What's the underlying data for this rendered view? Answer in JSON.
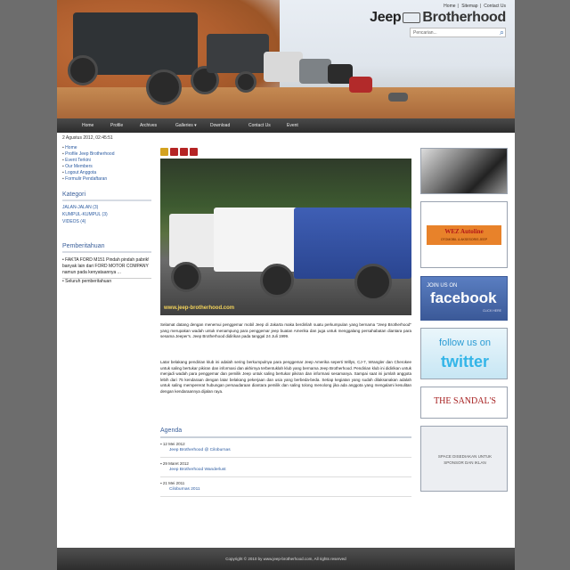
{
  "header": {
    "top_links": [
      "Home",
      "Sitemap",
      "Contact Us"
    ],
    "logo_left": "Jeep",
    "logo_right": "Brotherhood",
    "search_placeholder": "Pencarian..."
  },
  "nav": [
    "Home",
    "Profile",
    "Archives",
    "Galleries ▾",
    "Download",
    "Contact Us",
    "Event"
  ],
  "sidebar": {
    "date": "2 Agustus 2012, 02:45:51",
    "links": [
      "Home",
      "Profile Jeep Brotherhood",
      "Event Terkini",
      "Our Members",
      "Logout Anggota",
      "Formulir Pendaftaran"
    ],
    "category_title": "Kategori",
    "categories": [
      "JALAN-JALAN (3)",
      "KUMPUL-KUMPUL (3)",
      "VIDEOS (4)"
    ],
    "announcement_title": "Pemberitahuan",
    "announcement_text": "• FAKTA FORD M151 Pindah pindah pabrik! banyak lain dari FORD MOTOR COMPANY namun pada kenyataannya ...",
    "announcement_more": "• Seluruh pemberitahuan"
  },
  "main": {
    "photo_caption": "www.jeep-brotherhood.com",
    "paragraph1": "Selamat datang dengan menemui penggemar mobil Jeep di Jakarta maka berdirilah suatu perkumpulan yang bernama \"Jeep Brotherhood\" yang merupakan wadah untuk menampung para penggemar jeep buatan Amerika dan juga untuk menggalang persahabatan diantara para sesama Jeeper's. Jeep Brotherhood didirikan pada tanggal 24 Juli 1999.",
    "paragraph2": "Latar belakang pendirian klub ini adalah sering berkumpulnya para penggemar Jeep Amerika seperti Willys, CJ-7, Wrangler dan Cherokee untuk saling bertukar pikiran dan informasi dan akhirnya terbentuklah klub yang bernama Jeep Brotherhood. Pendirian klub ini didirikan untuk menjadi wadah para penggemar dan pemilik Jeep untuk saling bertukar pikiran dan informasi sesamanya. Sampai saat ini jumlah anggota lebih dari 75 kendaraan dengan latar belakang pekerjaan dan usia yang berbeda-beda. Setiap kegiatan yang sudah dilaksanakan adalah untuk saling mempererat hubungan persaudaraan diantara pemilik dan saling tolong menolong jika ada anggota yang mengalami kesulitan dengan kendaraannya dijalan raya.",
    "agenda_title": "Agenda",
    "agenda": [
      {
        "date": "12 Mei 2012",
        "title": "Jeep Brotherhood @ Ciloburnas"
      },
      {
        "date": "29 Maret 2012",
        "title": "Jeep Brotherhood Wanderlust"
      },
      {
        "date": "21 Mei 2011",
        "title": "Ciloburnas 2011"
      }
    ]
  },
  "ads": {
    "wez_title": "WEZ Autoline",
    "wez_sub": "OTOMOBIL & AKSESORIS JEEP",
    "facebook_top": "JOIN US ON",
    "facebook_main": "facebook",
    "facebook_sub": "CLICK HERE",
    "twitter_top": "follow us on",
    "twitter_main": "twitter",
    "sandals": "THE SANDAL'S",
    "sponsor_text": "SPACE DISEDIAKAN UNTUK SPONSOR DAN IKLAN"
  },
  "footer": {
    "copyright": "Copyright © 2010 by www.jeep-brotherhood.com, All rights reserved"
  }
}
